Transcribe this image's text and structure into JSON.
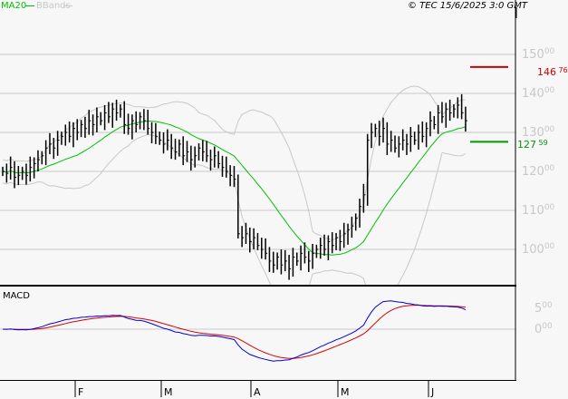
{
  "chart_data": {
    "type": "line",
    "title": "",
    "legend": [
      {
        "label": "MA20",
        "color": "#00c000"
      },
      {
        "label": "BBands",
        "color": "#c8c8c8"
      }
    ],
    "legend_placement": "top-left",
    "copyright": "© TEC 15/6/2025 3:0 GMT",
    "price_axis": {
      "ticks": [
        {
          "int": "150",
          "dec": "00",
          "v": 150
        },
        {
          "int": "140",
          "dec": "00",
          "v": 140
        },
        {
          "int": "130",
          "dec": "00",
          "v": 130
        },
        {
          "int": "120",
          "dec": "00",
          "v": 120
        },
        {
          "int": "110",
          "dec": "00",
          "v": 110
        },
        {
          "int": "100",
          "dec": "00",
          "v": 100
        }
      ],
      "ylim": [
        93,
        164
      ]
    },
    "levels": [
      {
        "int": "146",
        "dec": "76",
        "v": 146.76,
        "color": "#cc0000"
      },
      {
        "int": "127",
        "dec": "59",
        "v": 127.59,
        "color": "#009900"
      }
    ],
    "macd": {
      "label": "MACD",
      "ticks": [
        {
          "int": "5",
          "dec": "00",
          "v": 5
        },
        {
          "int": "0",
          "dec": "00",
          "v": 0
        }
      ],
      "macd_color": "#0000dd",
      "signal_color": "#dd0000"
    },
    "months": [
      "F",
      "M",
      "A",
      "M",
      "J"
    ],
    "closes": [
      120,
      119.5,
      121,
      118.5,
      119,
      120,
      119,
      121,
      122,
      123,
      124,
      126,
      127,
      126,
      128,
      129,
      130,
      129,
      131,
      130,
      132,
      131,
      133,
      132,
      134,
      133,
      135,
      134,
      136,
      135,
      136,
      132,
      131,
      133,
      132,
      134,
      133,
      131,
      130,
      129,
      128,
      127,
      128,
      126,
      125,
      127,
      124,
      125,
      123,
      124,
      126,
      125,
      124,
      123,
      124,
      122,
      121,
      120,
      119,
      118,
      104,
      103,
      104,
      102,
      103,
      101,
      100,
      99,
      97,
      96,
      98,
      96,
      97,
      95,
      98,
      97,
      99,
      98,
      97,
      99,
      100,
      101,
      100,
      102,
      101,
      103,
      102,
      104,
      105,
      106,
      108,
      111,
      114,
      128,
      130,
      131,
      129,
      131,
      127,
      128,
      126,
      127,
      128,
      127,
      129,
      128,
      130,
      129,
      131,
      133,
      132,
      135,
      134,
      136,
      135,
      136,
      137,
      135,
      133
    ]
  }
}
